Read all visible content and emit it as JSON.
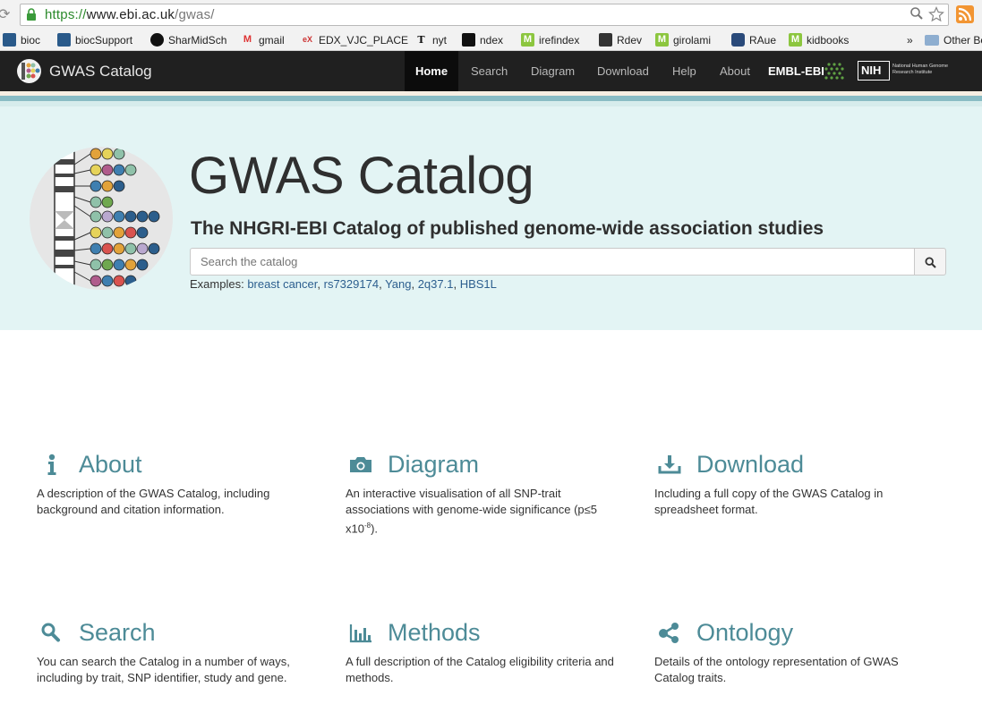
{
  "browser": {
    "url_scheme": "https://",
    "url_host": "www.ebi.ac.uk",
    "url_path": "/gwas/",
    "bookmarks": [
      {
        "label": "bioc"
      },
      {
        "label": "biocSupport"
      },
      {
        "label": "SharMidSch"
      },
      {
        "label": "gmail"
      },
      {
        "label": "EDX_VJC_PLACE"
      },
      {
        "label": "nyt"
      },
      {
        "label": "ndex"
      },
      {
        "label": "irefindex"
      },
      {
        "label": "Rdev"
      },
      {
        "label": "girolami"
      },
      {
        "label": "RAue"
      },
      {
        "label": "kidbooks"
      }
    ],
    "overflow": "»",
    "other_bookmarks": "Other Bo"
  },
  "navbar": {
    "brand": "GWAS Catalog",
    "items": [
      {
        "label": "Home"
      },
      {
        "label": "Search"
      },
      {
        "label": "Diagram"
      },
      {
        "label": "Download"
      },
      {
        "label": "Help"
      },
      {
        "label": "About"
      }
    ],
    "embl": "EMBL-EBI",
    "nih": "NIH",
    "nih_caption": "National Human Genome Research Institute"
  },
  "hero": {
    "title": "GWAS Catalog",
    "subtitle": "The NHGRI-EBI Catalog of published genome-wide association studies",
    "search_placeholder": "Search the catalog",
    "examples_label": "Examples:",
    "examples": [
      "breast cancer",
      "rs7329174",
      "Yang",
      "2q37.1",
      "HBS1L"
    ]
  },
  "tiles": [
    {
      "title": "About",
      "icon": "info-icon",
      "desc": "A description of the GWAS Catalog, including background and citation information."
    },
    {
      "title": "Diagram",
      "icon": "camera-icon",
      "desc_pre": "An interactive visualisation of all SNP-trait associations with genome-wide significance (p≤5 x10",
      "desc_sup": "-8",
      "desc_post": ")."
    },
    {
      "title": "Download",
      "icon": "download-icon",
      "desc": "Including a full copy of the GWAS Catalog in spreadsheet format."
    },
    {
      "title": "Search",
      "icon": "search-icon",
      "desc": "You can search the Catalog in a number of ways, including by trait, SNP identifier, study and gene."
    },
    {
      "title": "Methods",
      "icon": "bar-chart-icon",
      "desc": "A full description of the Catalog eligibility criteria and methods."
    },
    {
      "title": "Ontology",
      "icon": "share-icon",
      "desc": "Details of the ontology representation of GWAS Catalog traits."
    }
  ],
  "colors": {
    "navbar_bg": "#202020",
    "jumbo_bg": "#e3f4f4",
    "tile_title": "#4d8b97",
    "link": "#2d5f8f"
  }
}
